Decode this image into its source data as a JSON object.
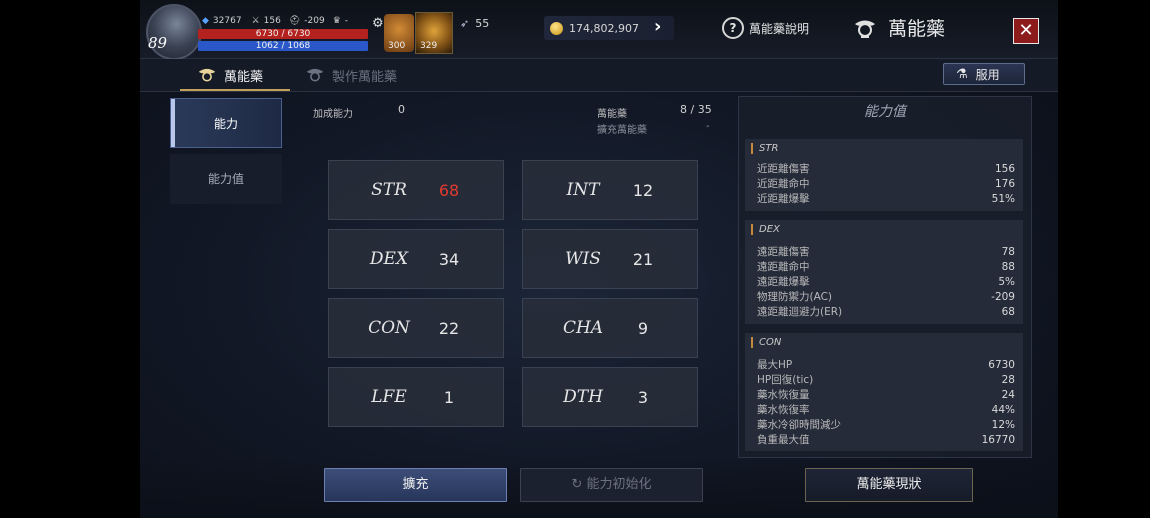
{
  "player": {
    "level": "89",
    "exp": "32767",
    "attack": "156",
    "defense": "-209",
    "trophy": "-",
    "hp": "6730 / 6730",
    "mp": "1062 / 1068"
  },
  "quick_slots": {
    "potion_count": "300",
    "skill_count": "329"
  },
  "currency": {
    "feather": "55",
    "gold": "174,802,907"
  },
  "header": {
    "help_label": "萬能藥說明",
    "title": "萬能藥",
    "close_label": "✕"
  },
  "tabs": {
    "active": "萬能藥",
    "inactive": "製作萬能藥",
    "use_label": "服用"
  },
  "sidebar": {
    "items": [
      "能力",
      "能力值"
    ]
  },
  "summary": {
    "bonus_label": "加成能力",
    "bonus_value": "0",
    "elixir_label": "萬能藥",
    "elixir_value": "8 / 35",
    "expand_label": "擴充萬能藥",
    "expand_value": "-"
  },
  "stats": [
    {
      "name": "STR",
      "value": "68"
    },
    {
      "name": "INT",
      "value": "12"
    },
    {
      "name": "DEX",
      "value": "34"
    },
    {
      "name": "WIS",
      "value": "21"
    },
    {
      "name": "CON",
      "value": "22"
    },
    {
      "name": "CHA",
      "value": "9"
    },
    {
      "name": "LFE",
      "value": "1"
    },
    {
      "name": "DTH",
      "value": "3"
    }
  ],
  "ability_panel": {
    "title": "能力值",
    "sections": [
      {
        "title": "STR",
        "rows": [
          {
            "label": "近距離傷害",
            "value": "156"
          },
          {
            "label": "近距離命中",
            "value": "176"
          },
          {
            "label": "近距離爆擊",
            "value": "51%"
          }
        ]
      },
      {
        "title": "DEX",
        "rows": [
          {
            "label": "遠距離傷害",
            "value": "78"
          },
          {
            "label": "遠距離命中",
            "value": "88"
          },
          {
            "label": "遠距離爆擊",
            "value": "5%"
          },
          {
            "label": "物理防禦力(AC)",
            "value": "-209"
          },
          {
            "label": "遠距離迴避力(ER)",
            "value": "68"
          }
        ]
      },
      {
        "title": "CON",
        "rows": [
          {
            "label": "最大HP",
            "value": "6730"
          },
          {
            "label": "HP回復(tic)",
            "value": "28"
          },
          {
            "label": "藥水恢復量",
            "value": "24"
          },
          {
            "label": "藥水恢復率",
            "value": "44%"
          },
          {
            "label": "藥水冷卻時間減少",
            "value": "12%"
          },
          {
            "label": "負重最大值",
            "value": "16770"
          }
        ]
      }
    ]
  },
  "buttons": {
    "expand": "擴充",
    "reset": "能力初始化",
    "status": "萬能藥現狀"
  },
  "colors": {
    "accent": "#c4a15a",
    "hp_bar": "#b3221f",
    "mp_bar": "#2b58c9",
    "highlight_value": "#e23a2f",
    "close_button": "#8e1b1b"
  }
}
